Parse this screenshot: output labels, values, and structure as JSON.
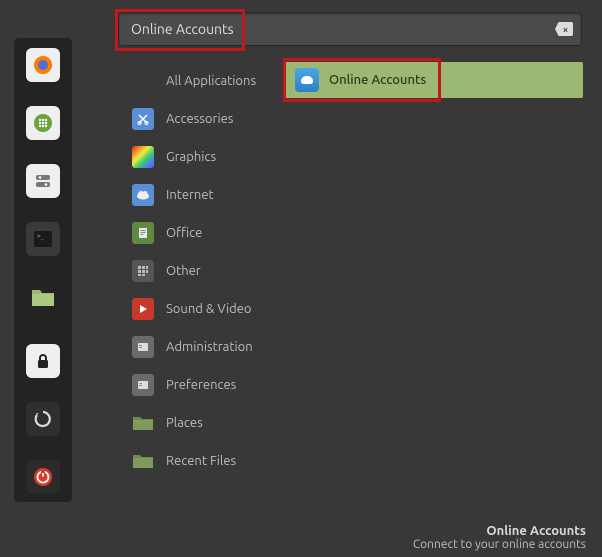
{
  "search": {
    "value": "Online Accounts"
  },
  "sidebar": [
    {
      "name": "firefox",
      "glyph": "🦊"
    },
    {
      "name": "apps",
      "glyph": "⠿"
    },
    {
      "name": "settings",
      "glyph": "⊟"
    },
    {
      "name": "terminal",
      "glyph": ">_"
    },
    {
      "name": "files",
      "glyph": "🗀"
    },
    {
      "name": "lock",
      "glyph": "🔒"
    },
    {
      "name": "logout",
      "glyph": "↻"
    },
    {
      "name": "power",
      "glyph": "⏻"
    }
  ],
  "categories": [
    {
      "label": "All Applications",
      "icon": null
    },
    {
      "label": "Accessories",
      "icon": "scissors"
    },
    {
      "label": "Graphics",
      "icon": "rainbow"
    },
    {
      "label": "Internet",
      "icon": "cloud"
    },
    {
      "label": "Office",
      "icon": "doc"
    },
    {
      "label": "Other",
      "icon": "grid"
    },
    {
      "label": "Sound & Video",
      "icon": "play"
    },
    {
      "label": "Administration",
      "icon": "panel"
    },
    {
      "label": "Preferences",
      "icon": "panel"
    },
    {
      "label": "Places",
      "icon": "folder"
    },
    {
      "label": "Recent Files",
      "icon": "folder"
    }
  ],
  "results": [
    {
      "label": "Online Accounts"
    }
  ],
  "tooltip": {
    "title": "Online Accounts",
    "desc": "Connect to your online accounts"
  }
}
